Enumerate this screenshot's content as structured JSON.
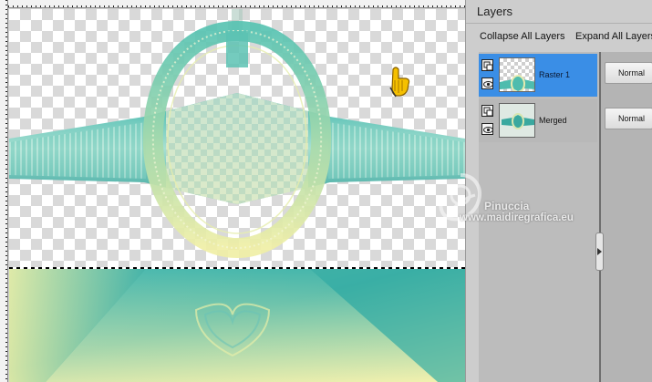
{
  "panel": {
    "title": "Layers",
    "collapse_label": "Collapse All Layers",
    "expand_label": "Expand All Layers"
  },
  "layers": [
    {
      "name": "Raster 1",
      "blend_mode": "Normal",
      "selected": true
    },
    {
      "name": "Merged",
      "blend_mode": "Normal",
      "selected": false
    }
  ],
  "watermark": {
    "line1": "Pinuccia",
    "line2": "www.maidiregrafica.eu"
  },
  "colors": {
    "accent_selected": "#3a8ee6",
    "teal": "#2bb0a6",
    "pale_yellow": "#f2f0a8"
  }
}
